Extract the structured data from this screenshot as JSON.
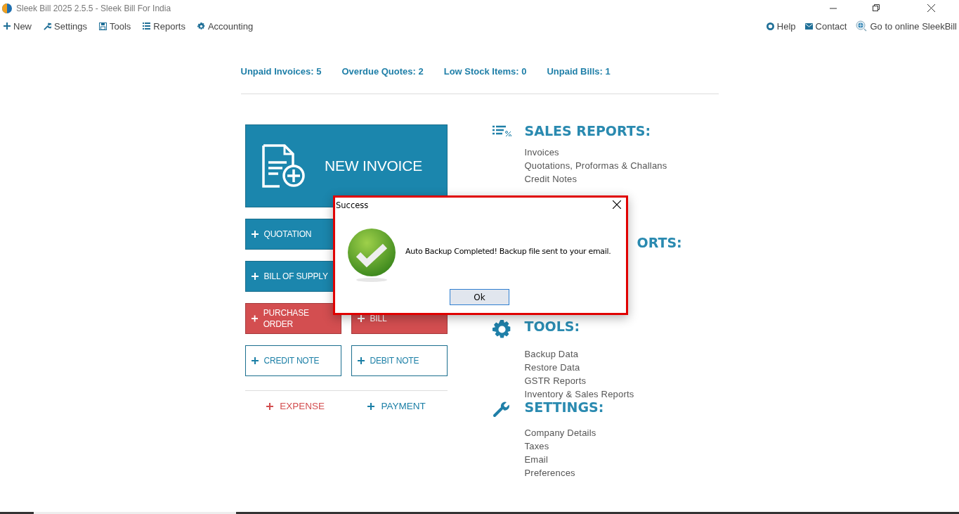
{
  "window": {
    "title": "Sleek Bill 2025 2.5.5 - Sleek Bill For India"
  },
  "menu": [
    {
      "label": "New"
    },
    {
      "label": "Settings"
    },
    {
      "label": "Tools"
    },
    {
      "label": "Reports"
    },
    {
      "label": "Accounting"
    }
  ],
  "right_menu": [
    {
      "label": "Help"
    },
    {
      "label": "Contact"
    },
    {
      "label": "Go to online SleekBill"
    }
  ],
  "stats": [
    {
      "label": "Unpaid Invoices:",
      "count": "5"
    },
    {
      "label": "Overdue Quotes:",
      "count": "2"
    },
    {
      "label": "Low Stock Items:",
      "count": "0"
    },
    {
      "label": "Unpaid Bills:",
      "count": "1"
    }
  ],
  "actions": [
    {
      "label": "NEW INVOICE",
      "kind": "hero"
    },
    {
      "label": "QUOTATION",
      "kind": "blue"
    },
    {
      "label": "BILL OF SUPPLY",
      "kind": "blue"
    },
    {
      "label": "PURCHASE ORDER",
      "kind": "red"
    },
    {
      "label": "BILL",
      "kind": "red"
    },
    {
      "label": "CREDIT NOTE",
      "kind": "outline"
    },
    {
      "label": "DEBIT NOTE",
      "kind": "outline"
    }
  ],
  "links": [
    {
      "label": "EXPENSE",
      "kind": "red"
    },
    {
      "label": "PAYMENT",
      "kind": "blue"
    }
  ],
  "sections": [
    {
      "title": "SALES REPORTS:",
      "kind": "sales",
      "items": [
        "Invoices",
        "Quotations, Proformas & Challans",
        "Credit Notes"
      ]
    },
    {
      "title": "ORTS:",
      "kind": "purchase"
    },
    {
      "title": "TOOLS:",
      "kind": "tools",
      "items": [
        "Backup Data",
        "Restore Data",
        "GSTR Reports",
        "Inventory & Sales Reports"
      ]
    },
    {
      "title": "SETTINGS:",
      "kind": "settings",
      "items": [
        "Company Details",
        "Taxes",
        "Email",
        "Preferences"
      ]
    }
  ],
  "dialog": {
    "title": "Success",
    "message": "Auto Backup Completed! Backup file sent to your email.",
    "button": "Ok"
  }
}
